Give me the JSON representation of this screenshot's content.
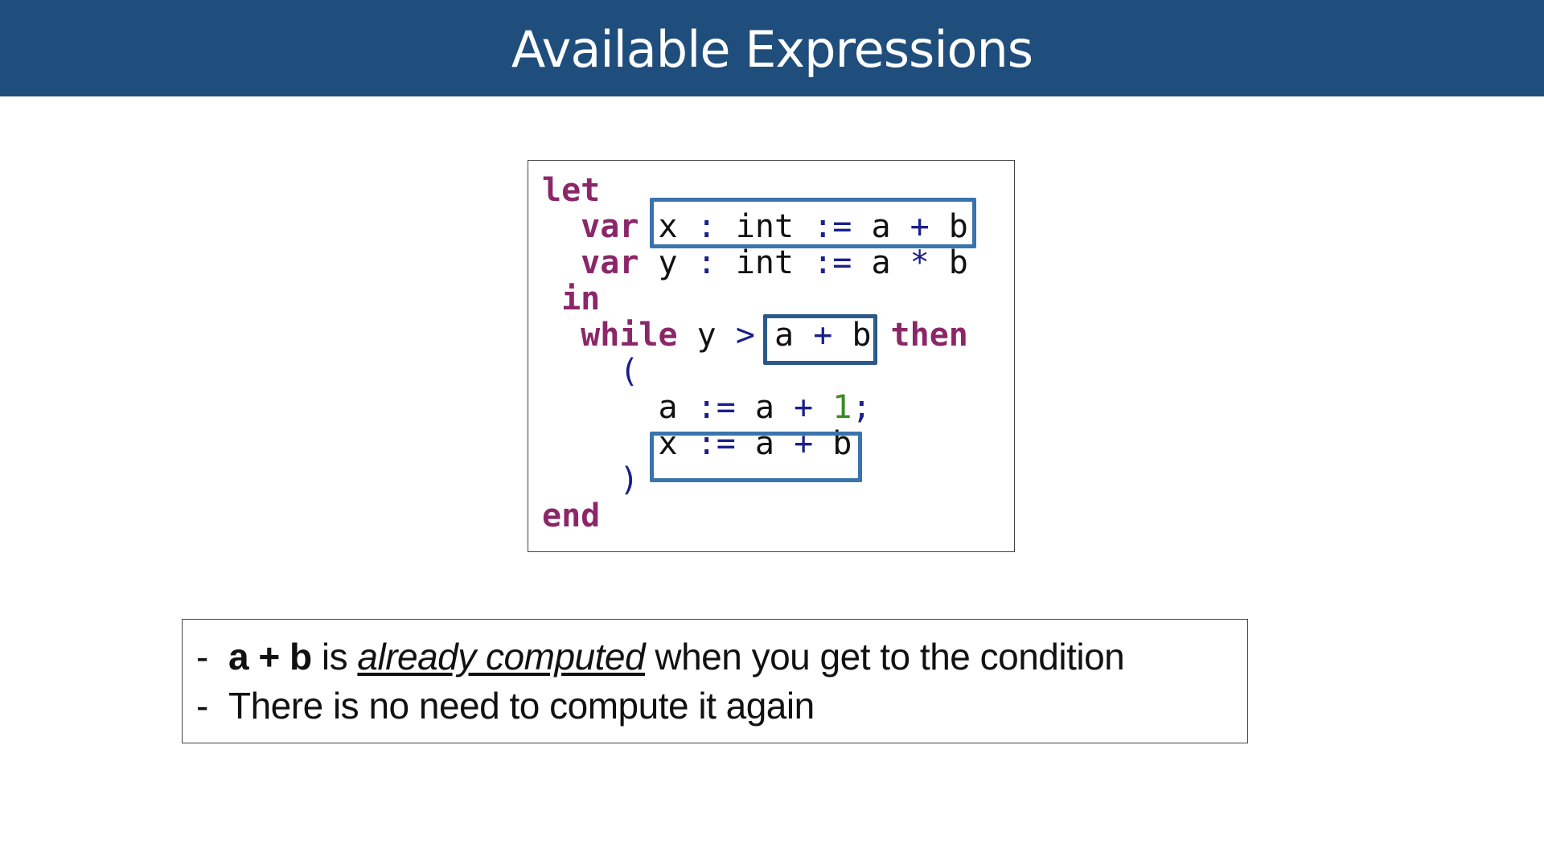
{
  "slide": {
    "title": "Available Expressions"
  },
  "code": {
    "lines": [
      [
        {
          "t": "let",
          "c": "kw"
        }
      ],
      [
        {
          "t": "  ",
          "c": "id"
        },
        {
          "t": "var",
          "c": "kw"
        },
        {
          "t": " x ",
          "c": "id"
        },
        {
          "t": ":",
          "c": "op"
        },
        {
          "t": " int ",
          "c": "id"
        },
        {
          "t": ":=",
          "c": "op"
        },
        {
          "t": " a ",
          "c": "id"
        },
        {
          "t": "+",
          "c": "op"
        },
        {
          "t": " b",
          "c": "id"
        }
      ],
      [
        {
          "t": "  ",
          "c": "id"
        },
        {
          "t": "var",
          "c": "kw"
        },
        {
          "t": " y ",
          "c": "id"
        },
        {
          "t": ":",
          "c": "op"
        },
        {
          "t": " int ",
          "c": "id"
        },
        {
          "t": ":=",
          "c": "op"
        },
        {
          "t": " a ",
          "c": "id"
        },
        {
          "t": "*",
          "c": "op"
        },
        {
          "t": " b",
          "c": "id"
        }
      ],
      [
        {
          "t": " ",
          "c": "id"
        },
        {
          "t": "in",
          "c": "kw"
        }
      ],
      [
        {
          "t": "  ",
          "c": "id"
        },
        {
          "t": "while",
          "c": "kw"
        },
        {
          "t": " y ",
          "c": "id"
        },
        {
          "t": ">",
          "c": "op"
        },
        {
          "t": " a ",
          "c": "id"
        },
        {
          "t": "+",
          "c": "op"
        },
        {
          "t": " b ",
          "c": "id"
        },
        {
          "t": "then",
          "c": "kw"
        }
      ],
      [
        {
          "t": "    ",
          "c": "id"
        },
        {
          "t": "(",
          "c": "op"
        }
      ],
      [
        {
          "t": "      a ",
          "c": "id"
        },
        {
          "t": ":=",
          "c": "op"
        },
        {
          "t": " a ",
          "c": "id"
        },
        {
          "t": "+",
          "c": "op"
        },
        {
          "t": " ",
          "c": "id"
        },
        {
          "t": "1",
          "c": "num"
        },
        {
          "t": ";",
          "c": "op"
        }
      ],
      [
        {
          "t": "      x ",
          "c": "id"
        },
        {
          "t": ":=",
          "c": "op"
        },
        {
          "t": " a ",
          "c": "id"
        },
        {
          "t": "+",
          "c": "op"
        },
        {
          "t": " b",
          "c": "id"
        }
      ],
      [
        {
          "t": "    ",
          "c": "id"
        },
        {
          "t": ")",
          "c": "op"
        }
      ],
      [
        {
          "t": "end",
          "c": "kw"
        }
      ]
    ]
  },
  "notes": {
    "line1": {
      "dash": "-",
      "bold": "a + b",
      "pre": " is ",
      "em": "already computed",
      "post": " when you get to the condition"
    },
    "line2": {
      "dash": "-",
      "text": "There is no need to compute it again"
    }
  },
  "colors": {
    "title_bar": "#1f4e7d",
    "keyword": "#8b2769",
    "operator": "#1a1f8c",
    "number": "#3a8a23",
    "highlight": "#3a74ad"
  }
}
